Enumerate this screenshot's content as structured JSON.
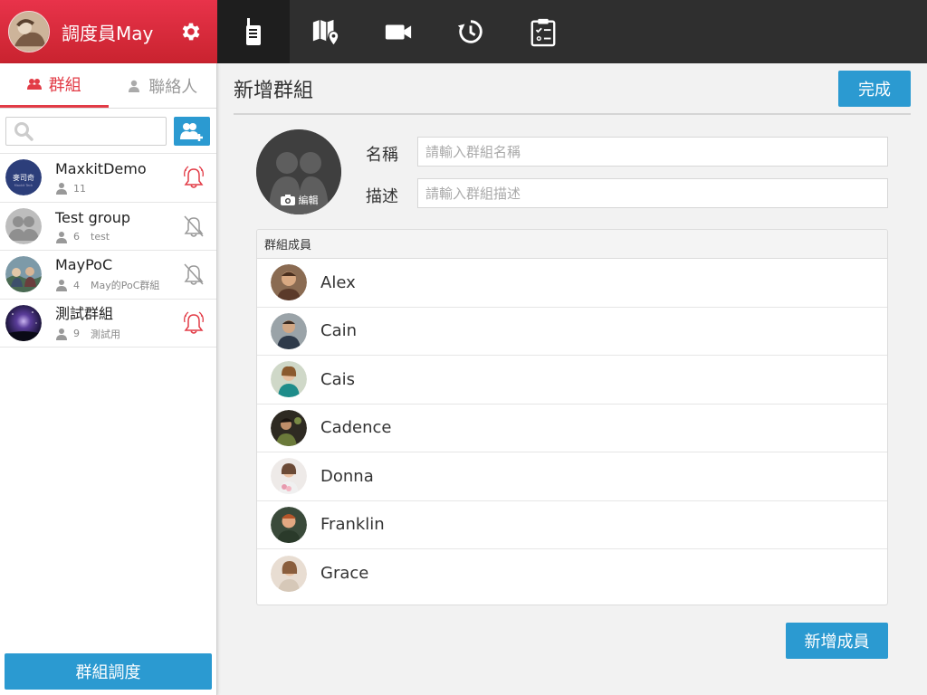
{
  "profile": {
    "name": "調度員May",
    "avatar_icon": "user-avatar",
    "settings_icon": "gear-icon"
  },
  "topnav": {
    "items": [
      {
        "name": "walkie-talkie",
        "icon": "radio-icon",
        "active": true
      },
      {
        "name": "map",
        "icon": "map-pin-icon",
        "active": false
      },
      {
        "name": "video",
        "icon": "video-camera-icon",
        "active": false
      },
      {
        "name": "history",
        "icon": "history-icon",
        "active": false
      },
      {
        "name": "tasks",
        "icon": "clipboard-icon",
        "active": false
      }
    ]
  },
  "sidebar": {
    "tabs": [
      {
        "label": "群組",
        "icon": "group-icon",
        "active": true
      },
      {
        "label": "聯絡人",
        "icon": "person-icon",
        "active": false
      }
    ],
    "search": {
      "placeholder": ""
    },
    "groups": [
      {
        "name": "MaxkitDemo",
        "count": "11",
        "desc": "",
        "alert": true
      },
      {
        "name": "Test group",
        "count": "6",
        "desc": "test",
        "alert": false
      },
      {
        "name": "MayPoC",
        "count": "4",
        "desc": "May的PoC群組",
        "alert": false
      },
      {
        "name": "測試群組",
        "count": "9",
        "desc": "測試用",
        "alert": true
      }
    ],
    "dispatch_label": "群組調度"
  },
  "main": {
    "title": "新增群組",
    "done_label": "完成",
    "photo_edit_label": "編輯",
    "name_label": "名稱",
    "name_placeholder": "請輸入群組名稱",
    "desc_label": "描述",
    "desc_placeholder": "請輸入群組描述",
    "members_header": "群組成員",
    "members": [
      {
        "name": "Alex"
      },
      {
        "name": "Cain"
      },
      {
        "name": "Cais"
      },
      {
        "name": "Cadence"
      },
      {
        "name": "Donna"
      },
      {
        "name": "Franklin"
      },
      {
        "name": "Grace"
      }
    ],
    "add_member_label": "新增成員"
  },
  "colors": {
    "accent_red": "#e23b46",
    "accent_blue": "#2b9ad1",
    "topbar_dark": "#2f2f2f"
  }
}
